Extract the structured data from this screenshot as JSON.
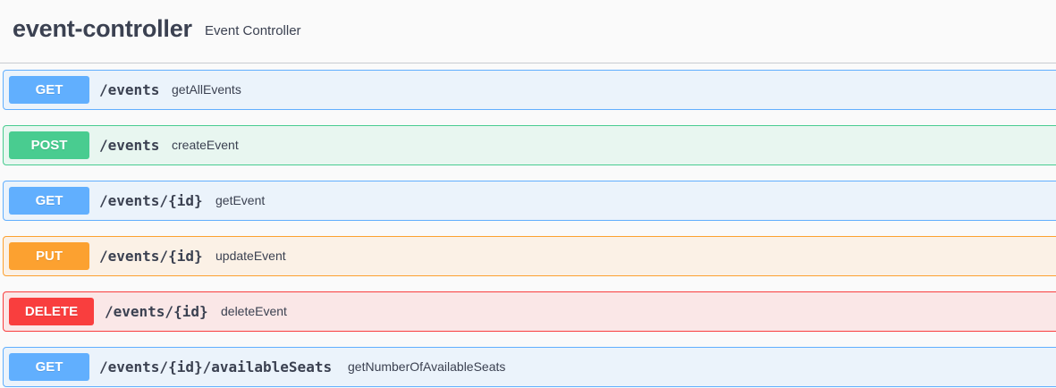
{
  "section": {
    "title": "event-controller",
    "description": "Event Controller"
  },
  "operations": [
    {
      "method": "GET",
      "path": "/events",
      "summary": "getAllEvents"
    },
    {
      "method": "POST",
      "path": "/events",
      "summary": "createEvent"
    },
    {
      "method": "GET",
      "path": "/events/{id}",
      "summary": "getEvent"
    },
    {
      "method": "PUT",
      "path": "/events/{id}",
      "summary": "updateEvent"
    },
    {
      "method": "DELETE",
      "path": "/events/{id}",
      "summary": "deleteEvent"
    },
    {
      "method": "GET",
      "path": "/events/{id}/availableSeats",
      "summary": "getNumberOfAvailableSeats"
    }
  ],
  "colors": {
    "get": "#61affe",
    "post": "#49cc90",
    "put": "#fca130",
    "delete": "#f93e3e",
    "text": "#3b4151"
  }
}
